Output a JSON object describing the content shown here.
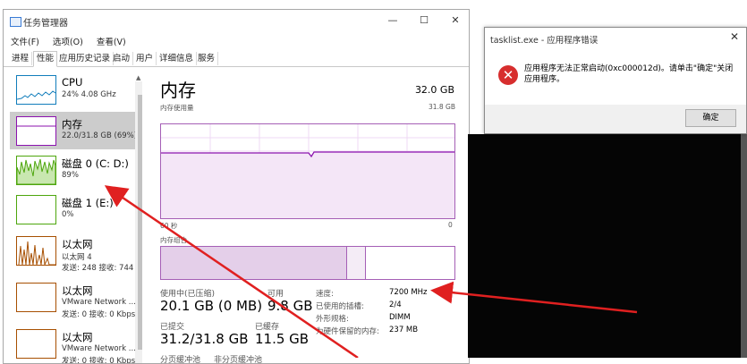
{
  "task_manager": {
    "title": "任务管理器",
    "menu": [
      "文件(F)",
      "选项(O)",
      "查看(V)"
    ],
    "tabs": [
      "进程",
      "性能",
      "应用历史记录",
      "启动",
      "用户",
      "详细信息",
      "服务"
    ],
    "active_tab": "性能",
    "sidebar": [
      {
        "name": "CPU",
        "sub": "24% 4.08 GHz",
        "color": "#117dbb"
      },
      {
        "name": "内存",
        "sub": "22.0/31.8 GB (69%)",
        "color": "#8b12ae"
      },
      {
        "name": "磁盘 0 (C: D:)",
        "sub": "89%",
        "color": "#4da60c"
      },
      {
        "name": "磁盘 1 (E:)",
        "sub": "0%",
        "color": "#4da60c"
      },
      {
        "name": "以太网",
        "sub": "以太网 4",
        "sub2": "发送: 248 接收: 744",
        "color": "#a74f01"
      },
      {
        "name": "以太网",
        "sub": "VMware Network ...",
        "sub2": "发送: 0 接收: 0 Kbps",
        "color": "#a74f01"
      },
      {
        "name": "以太网",
        "sub": "VMware Network ...",
        "sub2": "发送: 0 接收: 0 Kbps",
        "color": "#a74f01"
      }
    ],
    "main": {
      "title": "内存",
      "capacity": "32.0 GB",
      "usage_label": "内存使用量",
      "usage_max": "31.8 GB",
      "time_left": "60 秒",
      "time_right": "0",
      "composition_label": "内存组合",
      "in_use_label": "使用中(已压缩)",
      "in_use_value": "20.1 GB (0 MB)",
      "available_label": "可用",
      "available_value": "9.8 GB",
      "committed_label": "已提交",
      "committed_value": "31.2/31.8 GB",
      "cached_label": "已缓存",
      "cached_value": "11.5 GB",
      "paged_label": "分页缓冲池",
      "nonpaged_label": "非分页缓冲池",
      "details": [
        {
          "label": "速度:",
          "value": "7200 MHz"
        },
        {
          "label": "已使用的插槽:",
          "value": "2/4"
        },
        {
          "label": "外形规格:",
          "value": "DIMM"
        },
        {
          "label": "为硬件保留的内存:",
          "value": "237 MB"
        }
      ]
    }
  },
  "dialog": {
    "title": "tasklist.exe - 应用程序错误",
    "message": "应用程序无法正常启动(0xc000012d)。请单击\"确定\"关闭应用程序。",
    "ok_label": "确定"
  }
}
